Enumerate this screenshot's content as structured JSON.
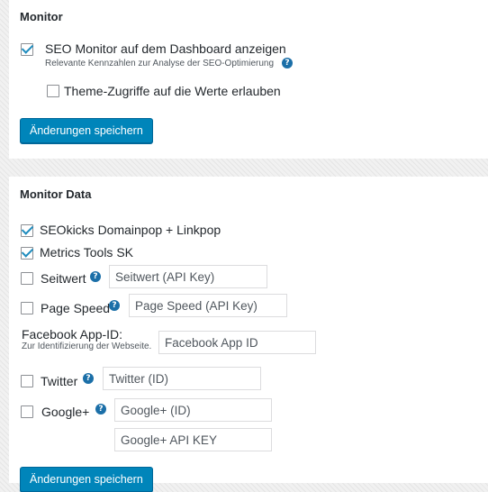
{
  "monitor": {
    "title": "Monitor",
    "seo_monitor": {
      "label": "SEO Monitor auf dem Dashboard anzeigen",
      "desc": "Relevante Kennzahlen zur Analyse der SEO-Optimierung",
      "checked": true
    },
    "theme_access": {
      "label": "Theme-Zugriffe auf die Werte erlauben",
      "checked": false
    },
    "save_label": "Änderungen speichern"
  },
  "monitor_data": {
    "title": "Monitor Data",
    "seokicks": {
      "label": "SEOkicks Domainpop + Linkpop",
      "checked": true
    },
    "metrics": {
      "label": "Metrics Tools SK",
      "checked": true
    },
    "seitwert": {
      "label": "Seitwert",
      "checked": false,
      "placeholder": "Seitwert (API Key)"
    },
    "pagespeed": {
      "label": "Page Speed",
      "checked": false,
      "placeholder": "Page Speed (API Key)"
    },
    "facebook": {
      "label": "Facebook App-ID:",
      "desc": "Zur Identifizierung der Webseite.",
      "placeholder": "Facebook App ID"
    },
    "twitter": {
      "label": "Twitter",
      "checked": false,
      "placeholder": "Twitter (ID)"
    },
    "google": {
      "label": "Google+",
      "checked": false,
      "placeholder": "Google+ (ID)",
      "api_placeholder": "Google+ API KEY"
    },
    "save_label": "Änderungen speichern"
  },
  "icons": {
    "help": "?"
  },
  "colors": {
    "accent": "#0085ba",
    "check": "#1e8cbe",
    "help": "#1b6fa8"
  }
}
